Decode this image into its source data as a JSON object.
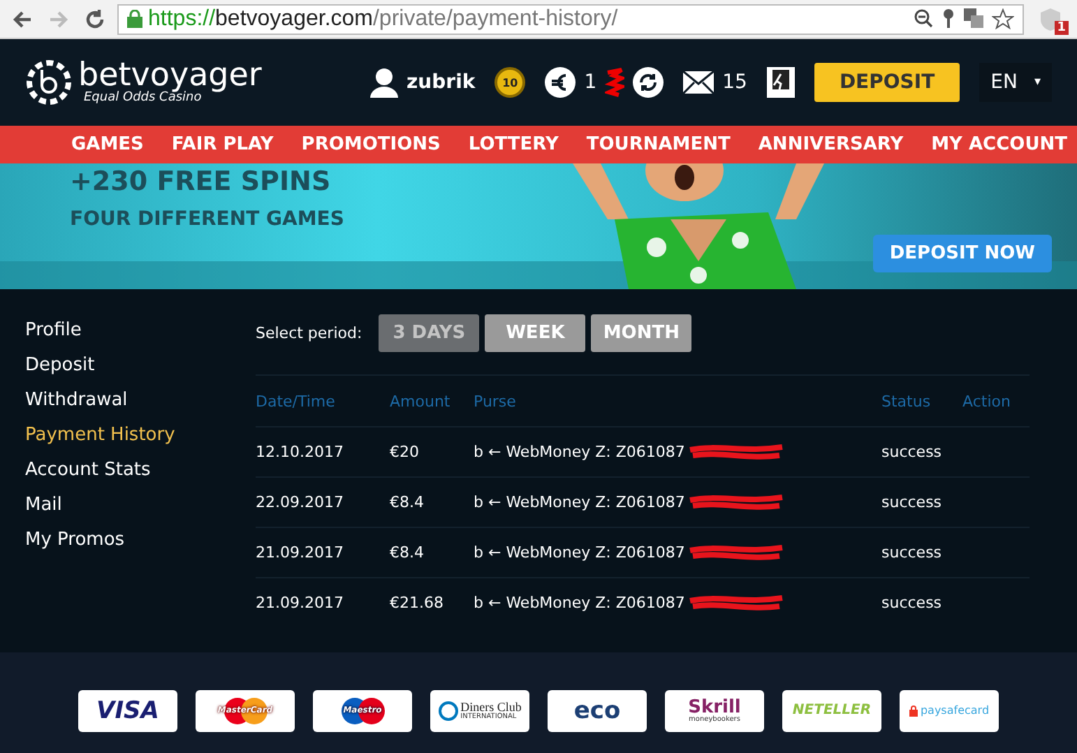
{
  "browser": {
    "url_scheme": "https://",
    "url_host": "betvoyager.com",
    "url_path": "/private/payment-history/",
    "badge": "1"
  },
  "header": {
    "logo": "betvoyager",
    "tagline": "Equal Odds Casino",
    "username": "zubrik",
    "coin_label": "10",
    "balance": "1",
    "messages": "15",
    "deposit": "DEPOSIT",
    "language": "EN",
    "caret": "▾"
  },
  "nav": [
    "GAMES",
    "FAIR PLAY",
    "PROMOTIONS",
    "LOTTERY",
    "TOURNAMENT",
    "ANNIVERSARY",
    "MY ACCOUNT"
  ],
  "banner": {
    "headline": "+230 FREE SPINS",
    "subline": "FOUR DIFFERENT GAMES",
    "button": "DEPOSIT NOW"
  },
  "sidebar": [
    {
      "label": "Profile",
      "selected": false
    },
    {
      "label": "Deposit",
      "selected": false
    },
    {
      "label": "Withdrawal",
      "selected": false
    },
    {
      "label": "Payment History",
      "selected": true
    },
    {
      "label": "Account Stats",
      "selected": false
    },
    {
      "label": "Mail",
      "selected": false
    },
    {
      "label": "My Promos",
      "selected": false
    }
  ],
  "period": {
    "label": "Select period:",
    "options": [
      {
        "label": "3 DAYS",
        "disabled": true
      },
      {
        "label": "WEEK",
        "disabled": false
      },
      {
        "label": "MONTH",
        "disabled": false
      }
    ]
  },
  "table": {
    "columns": [
      "Date/Time",
      "Amount",
      "Purse",
      "Status",
      "Action"
    ],
    "rows": [
      {
        "date": "12.10.2017",
        "amount": "€20",
        "purse": "b ← WebMoney Z: Z061087",
        "status": "success"
      },
      {
        "date": "22.09.2017",
        "amount": "€8.4",
        "purse": "b ← WebMoney Z: Z061087",
        "status": "success"
      },
      {
        "date": "21.09.2017",
        "amount": "€8.4",
        "purse": "b ← WebMoney Z: Z061087",
        "status": "success"
      },
      {
        "date": "21.09.2017",
        "amount": "€21.68",
        "purse": "b ← WebMoney Z: Z061087",
        "status": "success"
      }
    ]
  },
  "payments": [
    {
      "kind": "visa",
      "label": "VISA"
    },
    {
      "kind": "mastercard",
      "label": "MasterCard"
    },
    {
      "kind": "maestro",
      "label": "Maestro"
    },
    {
      "kind": "diners",
      "label": "Diners Club",
      "sub": "INTERNATIONAL"
    },
    {
      "kind": "eco",
      "label": "eco"
    },
    {
      "kind": "skrill",
      "label": "Skrill",
      "sub": "moneybookers"
    },
    {
      "kind": "neteller",
      "label": "NETELLER"
    },
    {
      "kind": "paysafe",
      "label": "paysafecard"
    }
  ]
}
